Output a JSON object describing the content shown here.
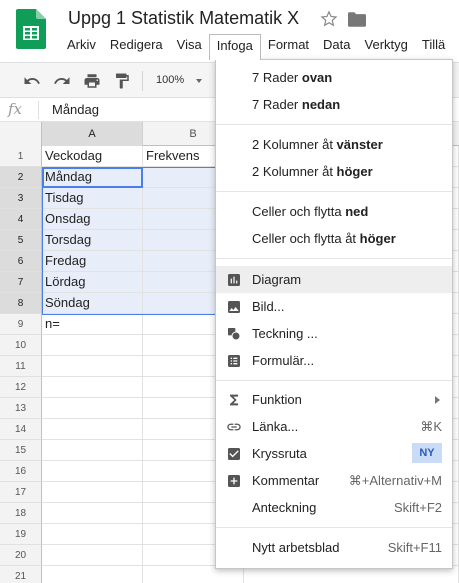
{
  "app": {
    "title": "Uppg 1 Statistik Matematik X",
    "menu": [
      "Arkiv",
      "Redigera",
      "Visa",
      "Infoga",
      "Format",
      "Data",
      "Verktyg",
      "Tillä"
    ],
    "active_menu": "Infoga"
  },
  "toolbar": {
    "zoom": "100%",
    "icons": [
      "undo-icon",
      "redo-icon",
      "print-icon",
      "paint-format-icon"
    ]
  },
  "formula": {
    "fx": "fx",
    "value": "Måndag"
  },
  "grid": {
    "columns": [
      "A",
      "B"
    ],
    "selected_column": "A",
    "rows": [
      {
        "num": "1",
        "a": "Veckodag",
        "b": "Frekvens"
      },
      {
        "num": "2",
        "a": "Måndag",
        "b": ""
      },
      {
        "num": "3",
        "a": "Tisdag",
        "b": ""
      },
      {
        "num": "4",
        "a": "Onsdag",
        "b": ""
      },
      {
        "num": "5",
        "a": "Torsdag",
        "b": ""
      },
      {
        "num": "6",
        "a": "Fredag",
        "b": ""
      },
      {
        "num": "7",
        "a": "Lördag",
        "b": ""
      },
      {
        "num": "8",
        "a": "Söndag",
        "b": ""
      },
      {
        "num": "9",
        "a": "n=",
        "b": ""
      },
      {
        "num": "10",
        "a": "",
        "b": ""
      },
      {
        "num": "11",
        "a": "",
        "b": ""
      },
      {
        "num": "12",
        "a": "",
        "b": ""
      },
      {
        "num": "13",
        "a": "",
        "b": ""
      },
      {
        "num": "14",
        "a": "",
        "b": ""
      },
      {
        "num": "15",
        "a": "",
        "b": ""
      },
      {
        "num": "16",
        "a": "",
        "b": ""
      },
      {
        "num": "17",
        "a": "",
        "b": ""
      },
      {
        "num": "18",
        "a": "",
        "b": ""
      },
      {
        "num": "19",
        "a": "",
        "b": ""
      },
      {
        "num": "20",
        "a": "",
        "b": ""
      },
      {
        "num": "21",
        "a": "",
        "b": ""
      }
    ]
  },
  "insert_menu": {
    "rows_above": {
      "pre": "7 Rader ",
      "bold": "ovan"
    },
    "rows_below": {
      "pre": "7 Rader ",
      "bold": "nedan"
    },
    "cols_left": {
      "pre": "2 Kolumner åt ",
      "bold": "vänster"
    },
    "cols_right": {
      "pre": "2 Kolumner åt ",
      "bold": "höger"
    },
    "cells_down": {
      "pre": "Celler och flytta ",
      "bold": "ned"
    },
    "cells_right": {
      "pre": "Celler och flytta åt ",
      "bold": "höger"
    },
    "chart": "Diagram",
    "image": "Bild...",
    "drawing": "Teckning ...",
    "form": "Formulär...",
    "function": "Funktion",
    "link": "Länka...",
    "link_shortcut": "⌘K",
    "checkbox": "Kryssruta",
    "checkbox_badge": "NY",
    "comment": "Kommentar",
    "comment_shortcut": "⌘+Alternativ+M",
    "note": "Anteckning",
    "note_shortcut": "Skift+F2",
    "new_sheet": "Nytt arbetsblad",
    "new_sheet_shortcut": "Skift+F11"
  },
  "colors": {
    "sheets_green": "#0f9d58",
    "selection_blue": "#4a7ee8",
    "selection_fill": "#e8eef9",
    "badge_fill": "#c8dcf8"
  }
}
